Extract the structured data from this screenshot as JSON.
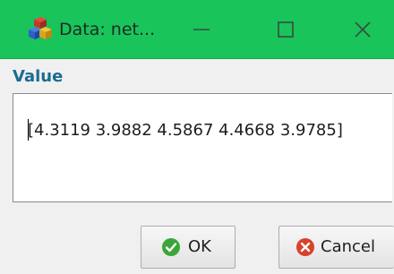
{
  "window": {
    "title": "Data: net...",
    "app_icon": "cubes-app-icon",
    "controls": [
      "minimize-icon",
      "maximize-icon",
      "close-icon"
    ],
    "titlebar_color": "#19c45b"
  },
  "field": {
    "label": "Value",
    "value": "[4.3119 3.9882 4.5867 4.4668 3.9785]"
  },
  "buttons": {
    "ok_label": "OK",
    "ok_icon": "check-circle-icon",
    "cancel_label": "Cancel",
    "cancel_icon": "cancel-circle-icon"
  },
  "colors": {
    "accent": "#1a6c91",
    "ok_green": "#3aa63a",
    "cancel_red": "#d9412b"
  }
}
